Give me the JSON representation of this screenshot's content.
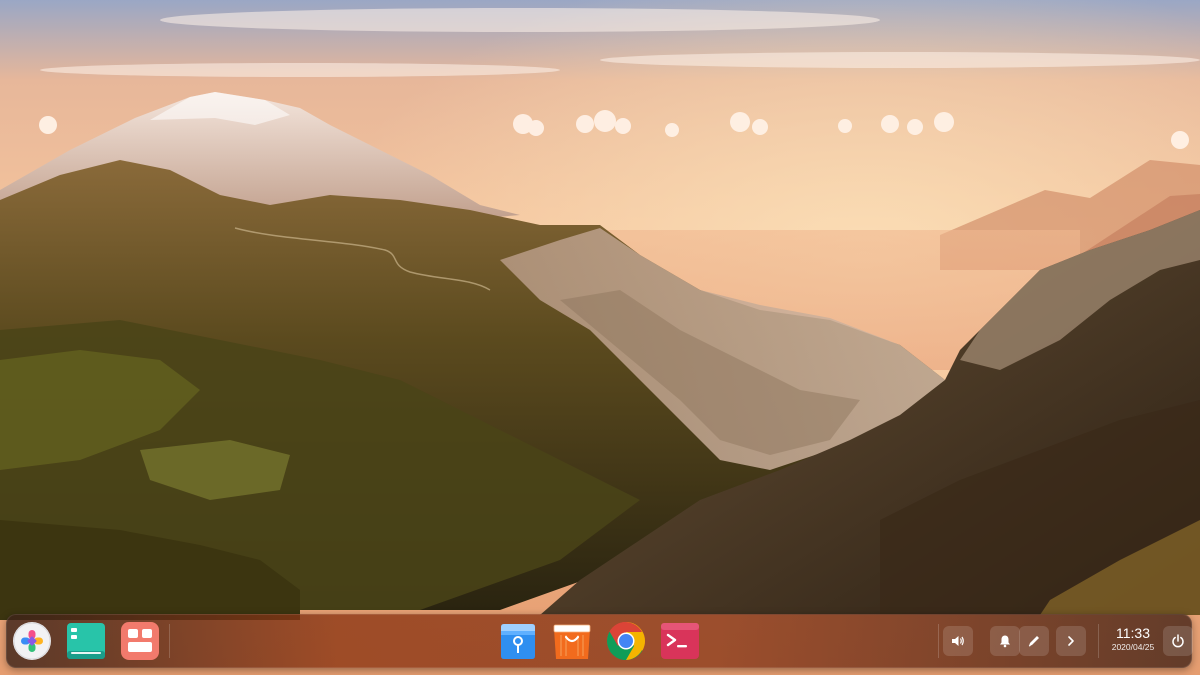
{
  "desktop": {
    "wallpaper": "mountain-sunset-landscape"
  },
  "dock": {
    "left_apps": [
      {
        "name": "launcher",
        "icon": "launcher-icon"
      },
      {
        "name": "multitasking-view",
        "icon": "multitasking-icon"
      },
      {
        "name": "workspace-manager",
        "icon": "workspace-grid-icon"
      }
    ],
    "center_apps": [
      {
        "name": "file-manager",
        "icon": "file-manager-icon"
      },
      {
        "name": "app-store",
        "icon": "app-store-icon"
      },
      {
        "name": "chrome",
        "icon": "chrome-icon"
      },
      {
        "name": "terminal",
        "icon": "terminal-icon"
      }
    ],
    "tray": [
      {
        "name": "volume",
        "icon": "volume-icon"
      },
      {
        "name": "notifications",
        "icon": "bell-icon"
      },
      {
        "name": "pen",
        "icon": "pen-icon"
      },
      {
        "name": "expand",
        "icon": "chevron-right-icon"
      }
    ],
    "clock": {
      "time": "11:33",
      "date": "2020/04/25"
    },
    "power": {
      "icon": "power-icon"
    }
  },
  "colors": {
    "dock_accent": "#8c3714",
    "terminal": "#d9345a",
    "file_manager": "#2d8ff0",
    "app_store": "#f26b1d"
  }
}
